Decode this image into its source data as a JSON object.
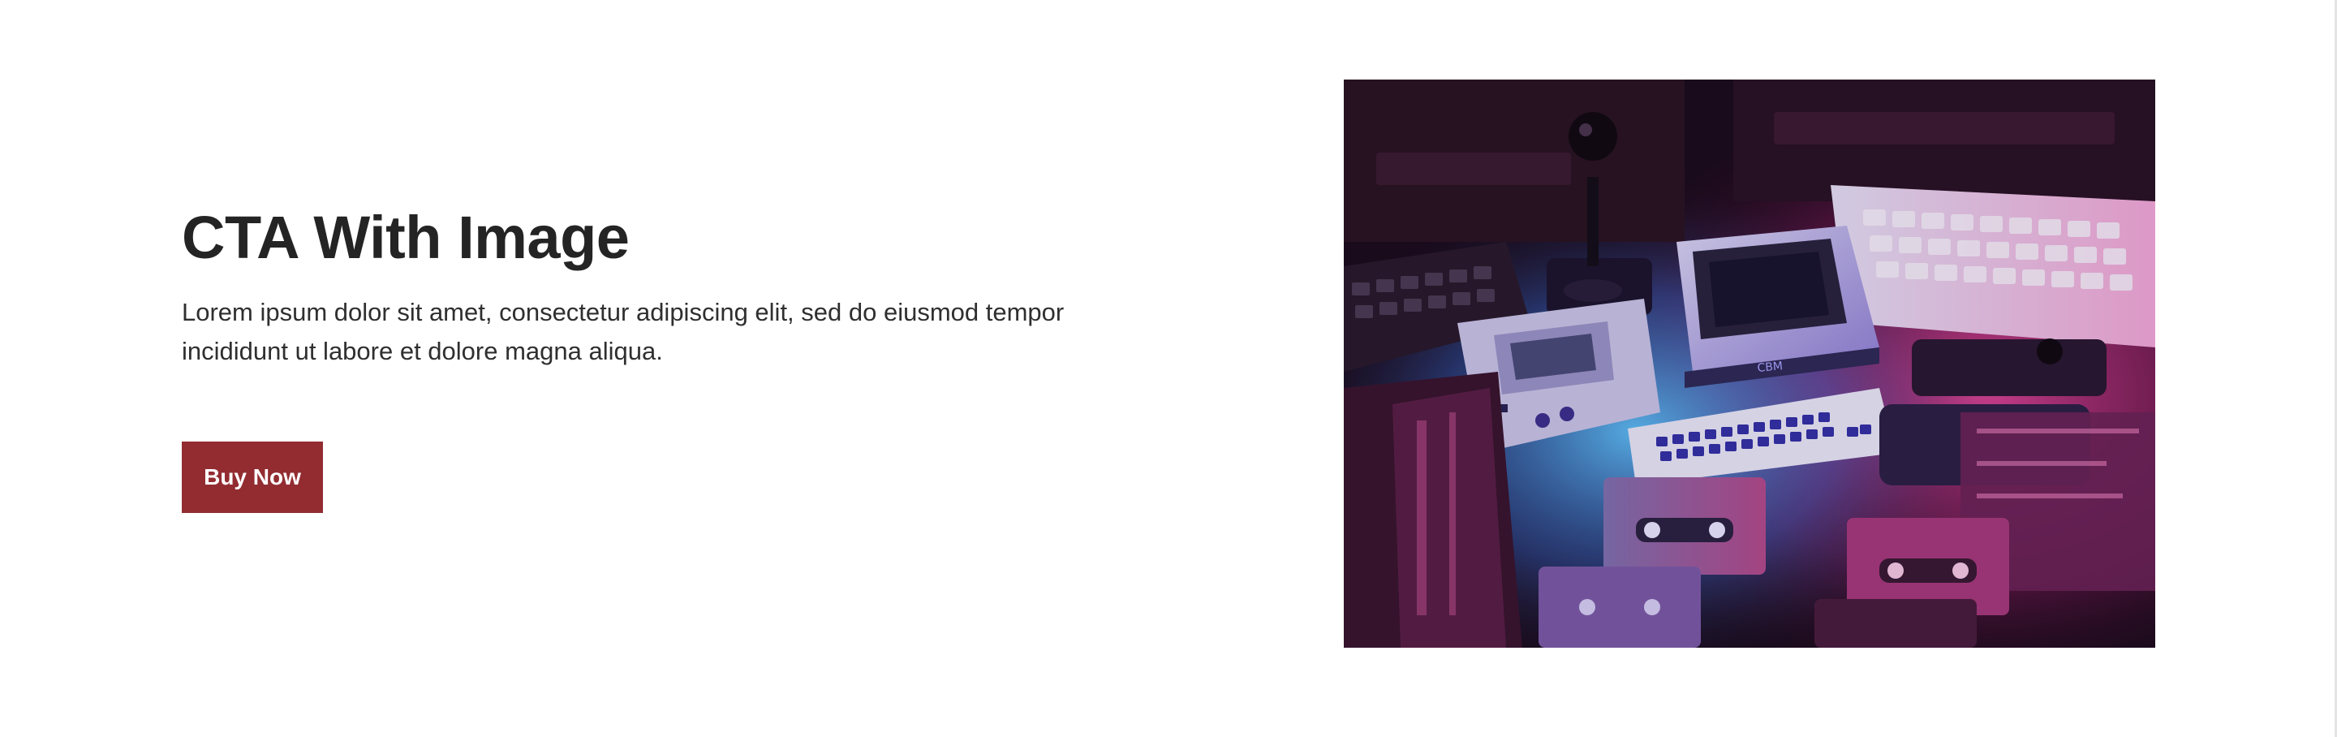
{
  "cta": {
    "title": "CTA With Image",
    "body": "Lorem ipsum dolor sit amet, consectetur adipiscing elit, sed do eiusmod tempor incididunt ut labore et dolore magna aliqua.",
    "button_label": "Buy Now"
  },
  "image": {
    "alt": "Retro computers, handheld console, joystick and cassette tapes lit in neon pink and blue"
  },
  "colors": {
    "button": "#922c31",
    "heading": "#242424",
    "text": "#2f2f2f",
    "background": "#ffffff",
    "neon_pink": "#e0449c",
    "neon_blue": "#46a6ff"
  }
}
